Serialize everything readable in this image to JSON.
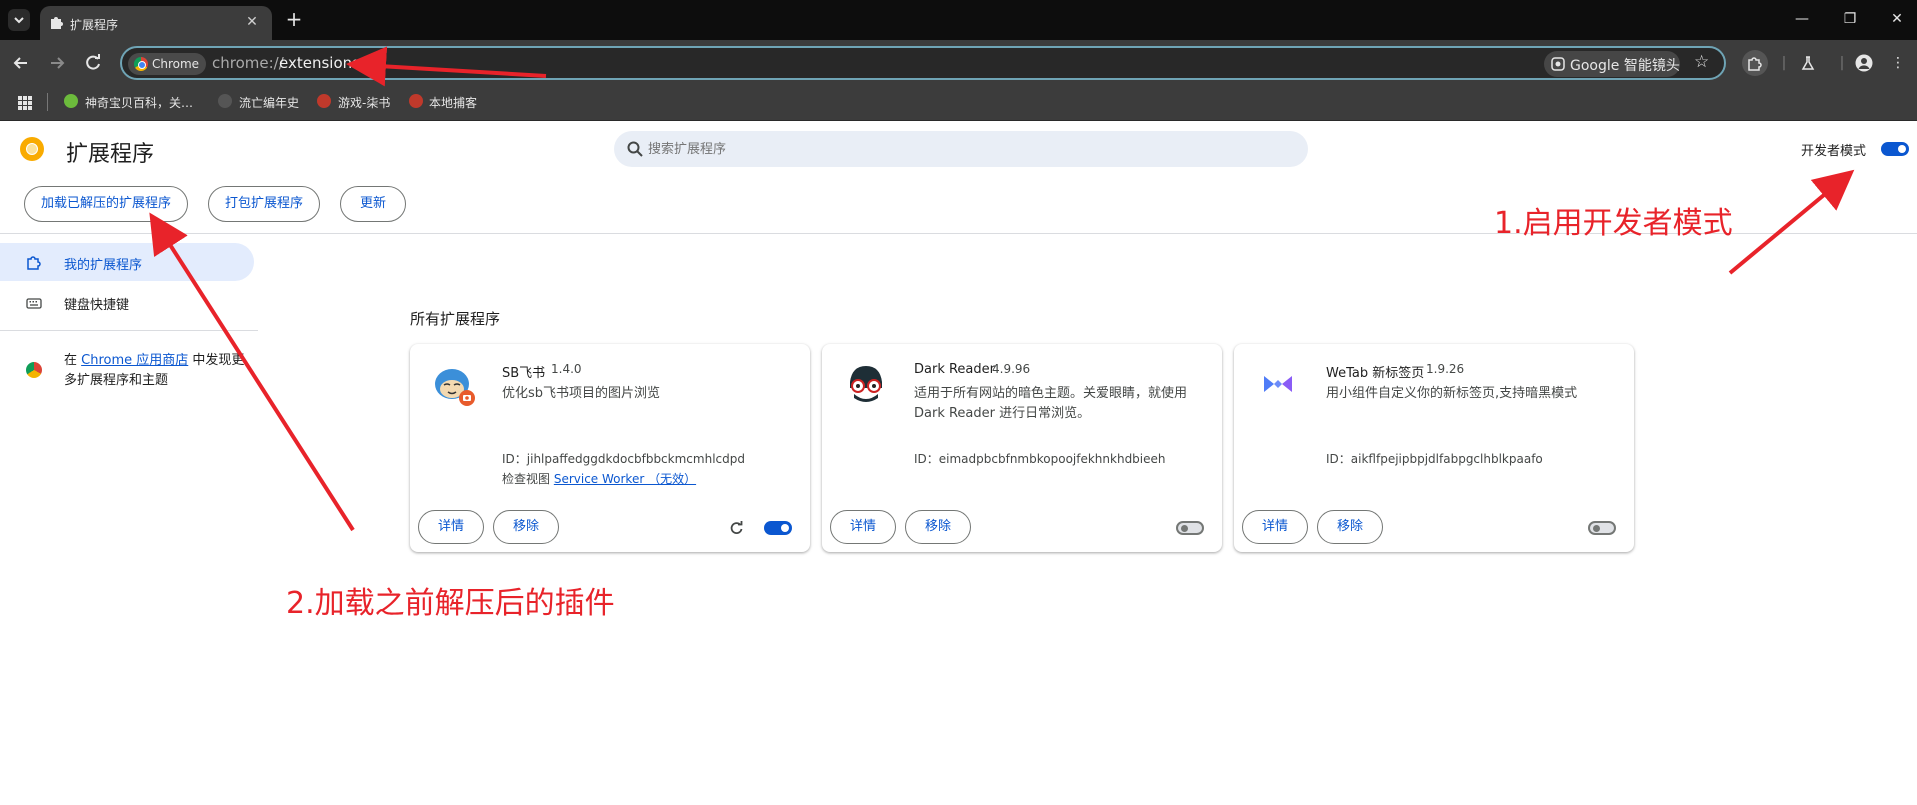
{
  "browser": {
    "tab": {
      "title": "扩展程序",
      "close": "✕"
    },
    "new_tab": "+",
    "window_controls": {
      "minimize": "—",
      "restore": "❐",
      "close": "✕"
    },
    "address": {
      "chip_label": "Chrome",
      "scheme": "chrome://",
      "host": "extensions"
    },
    "lens_label": "Google 智能镜头",
    "bookmarks": [
      "神奇宝贝百科，关…",
      "流亡编年史",
      "游戏-柒书",
      "本地捕客"
    ]
  },
  "page": {
    "title": "扩展程序",
    "search_placeholder": "搜索扩展程序",
    "developer_mode": {
      "label": "开发者模式",
      "enabled": true
    },
    "actions": {
      "load_unpacked": "加载已解压的扩展程序",
      "pack": "打包扩展程序",
      "update": "更新"
    },
    "sidebar": {
      "items": [
        {
          "label": "我的扩展程序",
          "active": true
        },
        {
          "label": "键盘快捷键",
          "active": false
        }
      ],
      "store": {
        "prefix": "在 ",
        "link": "Chrome 应用商店",
        "suffix": " 中发现更多扩展程序和主题"
      }
    },
    "section_title": "所有扩展程序",
    "extensions": [
      {
        "name": "SB飞书",
        "version": "1.4.0",
        "description": "优化sb飞书项目的图片浏览",
        "id_label": "ID：jihlpaffedggdkdocbfbbckmcmhlcdpd",
        "inspect_prefix": "检查视图 ",
        "inspect_link": "Service Worker （无效）",
        "details": "详情",
        "remove": "移除",
        "enabled": true,
        "icon": "cat-camera-icon"
      },
      {
        "name": "Dark Reader",
        "version": "4.9.96",
        "description": "适用于所有网站的暗色主题。关爱眼睛，就使用 Dark Reader 进行日常浏览。",
        "id_label": "ID：eimadpbcbfnmbkopoojfekhnkhdbieeh",
        "details": "详情",
        "remove": "移除",
        "enabled": false,
        "icon": "dark-reader-icon"
      },
      {
        "name": "WeTab 新标签页",
        "version": "1.9.26",
        "description": "用小组件自定义你的新标签页,支持暗黑模式",
        "id_label": "ID：aikflfpejipbpjdlfabpgclhblkpaafo",
        "details": "详情",
        "remove": "移除",
        "enabled": false,
        "icon": "wetab-icon"
      }
    ]
  },
  "annotations": {
    "step1": "1.启用开发者模式",
    "step2": "2.加载之前解压后的插件"
  },
  "colors": {
    "accent": "#0b57d0",
    "annotation": "#e8232a",
    "toolbar": "#3c3c3c"
  }
}
